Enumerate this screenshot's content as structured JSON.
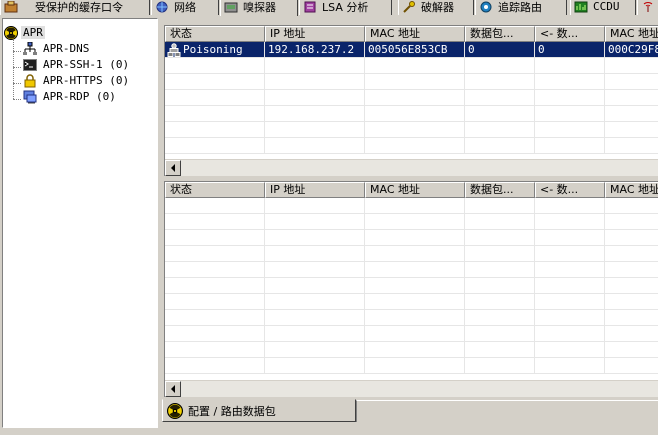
{
  "tabs": [
    {
      "label": "受保护的缓存口令",
      "icon": "protected-cache-icon"
    },
    {
      "label": "网络",
      "icon": "network-icon"
    },
    {
      "label": "嗅探器",
      "icon": "sniffer-icon",
      "active": true
    },
    {
      "label": "LSA 分析",
      "icon": "lsa-icon"
    },
    {
      "label": "破解器",
      "icon": "cracker-icon"
    },
    {
      "label": "追踪路由",
      "icon": "traceroute-icon"
    },
    {
      "label": "CCDU",
      "icon": "ccdu-icon"
    }
  ],
  "tree": {
    "root": "APR",
    "children": [
      {
        "label": "APR-DNS",
        "icon": "dns-icon"
      },
      {
        "label": "APR-SSH-1  (0)",
        "icon": "ssh-icon"
      },
      {
        "label": "APR-HTTPS  (0)",
        "icon": "https-lock-icon"
      },
      {
        "label": "APR-RDP  (0)",
        "icon": "rdp-icon"
      }
    ]
  },
  "upper_grid": {
    "columns": [
      "状态",
      "IP 地址",
      "MAC 地址",
      "数据包...",
      "<- 数...",
      "MAC 地址"
    ],
    "rows": [
      [
        "Poisoning",
        "192.168.237.2",
        "005056E853CB",
        "0",
        "0",
        "000C29F8"
      ]
    ]
  },
  "lower_grid": {
    "columns": [
      "状态",
      "IP 地址",
      "MAC 地址",
      "数据包...",
      "<- 数...",
      "MAC 地址"
    ],
    "rows": []
  },
  "bottom_tab": {
    "label": "配置 / 路由数据包",
    "icon": "apr-radiation-icon"
  },
  "colors": {
    "face": "#d4d0c8",
    "selection": "#0a246a",
    "radiation": "#f0d000"
  }
}
